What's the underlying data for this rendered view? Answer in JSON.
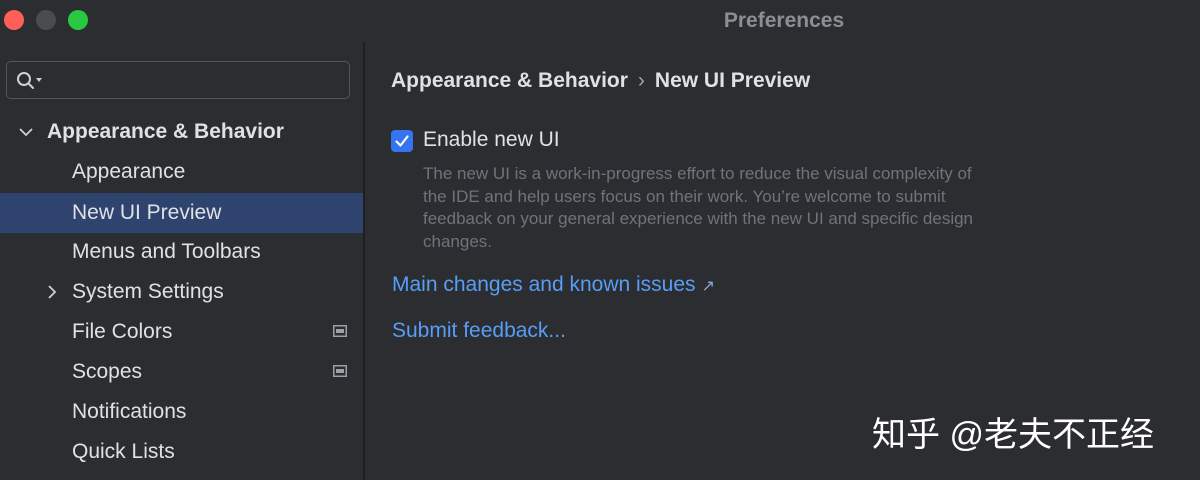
{
  "window": {
    "title": "Preferences"
  },
  "sidebar": {
    "search": {
      "value": "",
      "placeholder": ""
    },
    "items": [
      {
        "label": "Appearance & Behavior",
        "expanded": true,
        "level": 0
      },
      {
        "label": "Appearance",
        "level": 1
      },
      {
        "label": "New UI Preview",
        "level": 1,
        "selected": true
      },
      {
        "label": "Menus and Toolbars",
        "level": 1
      },
      {
        "label": "System Settings",
        "level": 1,
        "expandable": true
      },
      {
        "label": "File Colors",
        "level": 1,
        "project_level": true
      },
      {
        "label": "Scopes",
        "level": 1,
        "project_level": true
      },
      {
        "label": "Notifications",
        "level": 1
      },
      {
        "label": "Quick Lists",
        "level": 1
      }
    ]
  },
  "content": {
    "breadcrumb": {
      "parent": "Appearance & Behavior",
      "separator": "›",
      "current": "New UI Preview"
    },
    "checkbox": {
      "label": "Enable new UI",
      "checked": true
    },
    "description": "The new UI is a work-in-progress effort to reduce the visual complexity of the IDE and help users focus on their work. You’re welcome to submit feedback on your general experience with the new UI and specific design changes.",
    "links": {
      "changes": "Main changes and known issues",
      "changes_arrow": "↗",
      "feedback": "Submit feedback..."
    }
  },
  "watermark": "知乎 @老夫不正经",
  "colors": {
    "background": "#2b2d30",
    "selection": "#2e436e",
    "accent": "#3574f0",
    "link": "#589df6",
    "text": "#dfe1e5",
    "muted": "#6f737a"
  }
}
